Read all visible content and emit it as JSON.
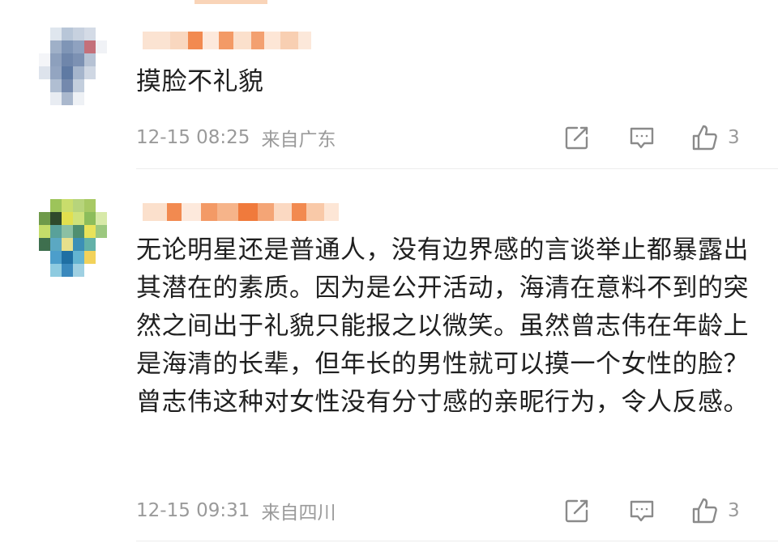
{
  "comments": [
    {
      "text": "摸脸不礼貌",
      "time": "12-15 08:25",
      "location": "来自广东",
      "like_count": "3",
      "share_icon": "share-edit-icon",
      "comment_icon": "comment-bubble-icon",
      "like_icon": "thumbs-up-icon"
    },
    {
      "text": "无论明星还是普通人，没有边界感的言谈举止都暴露出其潜在的素质。因为是公开活动，海清在意料不到的突然之间出于礼貌只能报之以微笑。虽然曾志伟在年龄上是海清的长辈，但年长的男性就可以摸一个女性的脸？曾志伟这种对女性没有分寸感的亲昵行为，令人反感。",
      "time": "12-15 09:31",
      "location": "来自四川",
      "like_count": "3",
      "share_icon": "share-edit-icon",
      "comment_icon": "comment-bubble-icon",
      "like_icon": "thumbs-up-icon"
    }
  ],
  "colors": {
    "text": "#1f1f1f",
    "meta": "#9a9a9a",
    "icon": "#8a8a8a",
    "divider": "#ececec"
  }
}
